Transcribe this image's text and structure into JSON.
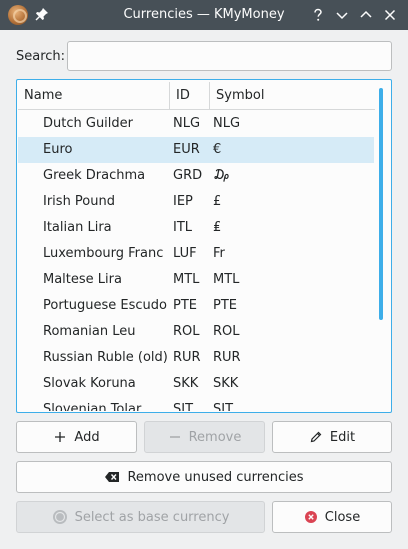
{
  "window": {
    "title": "Currencies — KMyMoney"
  },
  "search": {
    "label": "Search:",
    "value": "",
    "placeholder": ""
  },
  "table": {
    "columns": [
      "Name",
      "ID",
      "Symbol"
    ],
    "rows": [
      {
        "name": "Dutch Guilder",
        "id": "NLG",
        "symbol": "NLG"
      },
      {
        "name": "Euro",
        "id": "EUR",
        "symbol": "€"
      },
      {
        "name": "Greek Drachma",
        "id": "GRD",
        "symbol": "₯"
      },
      {
        "name": "Irish Pound",
        "id": "IEP",
        "symbol": "£"
      },
      {
        "name": "Italian Lira",
        "id": "ITL",
        "symbol": "₤"
      },
      {
        "name": "Luxembourg Franc",
        "id": "LUF",
        "symbol": "Fr"
      },
      {
        "name": "Maltese Lira",
        "id": "MTL",
        "symbol": "MTL"
      },
      {
        "name": "Portuguese Escudo",
        "id": "PTE",
        "symbol": "PTE"
      },
      {
        "name": "Romanian Leu",
        "id": "ROL",
        "symbol": "ROL"
      },
      {
        "name": "Russian Ruble (old)",
        "id": "RUR",
        "symbol": "RUR"
      },
      {
        "name": "Slovak Koruna",
        "id": "SKK",
        "symbol": "SKK"
      },
      {
        "name": "Slovenian Tolar",
        "id": "SIT",
        "symbol": "SIT"
      }
    ],
    "selected_index": 1
  },
  "buttons": {
    "add": "Add",
    "remove": "Remove",
    "edit": "Edit",
    "remove_unused": "Remove unused currencies",
    "select_base": "Select as base currency",
    "close": "Close"
  },
  "colors": {
    "titlebar": "#475057",
    "accent": "#3daee9",
    "selection": "#d6ebf7",
    "close_icon": "#da4453"
  }
}
